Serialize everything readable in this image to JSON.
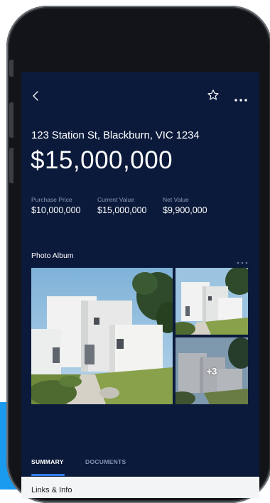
{
  "property": {
    "address": "123 Station St, Blackburn, VIC 1234",
    "price": "$15,000,000"
  },
  "stats": [
    {
      "label": "Purchase Price",
      "value": "$10,000,000"
    },
    {
      "label": "Current Value",
      "value": "$15,000,000"
    },
    {
      "label": "Net Value",
      "value": "$9,900,000"
    }
  ],
  "album": {
    "title": "Photo Album",
    "more_count": "+3"
  },
  "tabs": {
    "summary": "SUMMARY",
    "documents": "DOCUMENTS"
  },
  "sheet": {
    "heading": "Links & Info"
  },
  "icons": [
    "back-icon",
    "star-icon",
    "more-icon"
  ],
  "colors": {
    "screen_bg": "#0b1a3b",
    "accent": "#2f7cf0",
    "muted_label": "#8c98b4"
  }
}
